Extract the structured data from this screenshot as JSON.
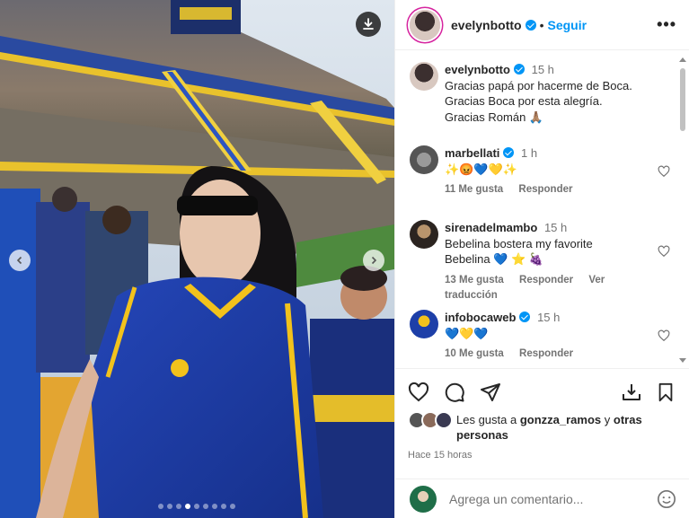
{
  "post": {
    "username": "evelynbotto",
    "follow_label": "Seguir",
    "separator": "•",
    "more_label": "•••",
    "caption_time": "15 h",
    "caption_lines": [
      "Gracias papá por hacerme de Boca.",
      "Gracias Boca por esta alegría.",
      "Gracias Román 🙏🏽"
    ],
    "carousel_total": 9,
    "carousel_active": 4
  },
  "comments": [
    {
      "username": "marbellati",
      "verified": true,
      "time": "1 h",
      "text_lines": [
        "✨😡💙💛✨"
      ],
      "likes": "11 Me gusta",
      "reply": "Responder",
      "translate": ""
    },
    {
      "username": "sirenadelmambo",
      "verified": false,
      "time": "15 h",
      "text_lines": [
        "Bebelina bostera my favorite",
        "Bebelina 💙 ⭐ 🍇"
      ],
      "likes": "13 Me gusta",
      "reply": "Responder",
      "translate": "Ver traducción"
    },
    {
      "username": "infobocaweb",
      "verified": true,
      "time": "15 h",
      "text_lines": [
        "💙💛💙"
      ],
      "likes": "10 Me gusta",
      "reply": "Responder",
      "translate": ""
    }
  ],
  "likes_summary": {
    "prefix": "Les gusta a",
    "user": "gonzza_ramos",
    "middle": "y",
    "suffix_line1": "otras",
    "suffix_line2": "personas"
  },
  "posted_ago": "Hace 15 horas",
  "add_comment": {
    "placeholder": "Agrega un comentario..."
  },
  "icons": {
    "download": "download-icon",
    "prev": "chevron-left-icon",
    "next": "chevron-right-icon",
    "like": "heart-icon",
    "comment": "comment-icon",
    "share": "send-icon",
    "save": "bookmark-icon",
    "emoji": "emoji-icon"
  },
  "colors": {
    "accent": "#0095f6",
    "boca_blue": "#1d3fa8",
    "boca_gold": "#f5c518"
  }
}
